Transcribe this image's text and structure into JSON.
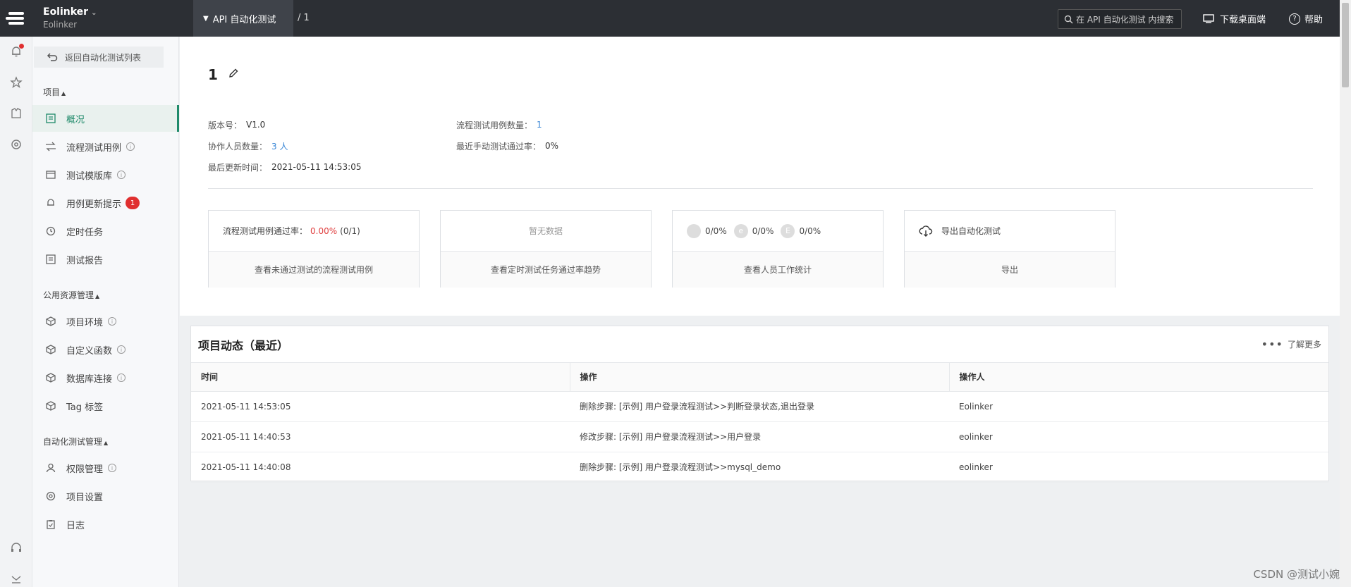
{
  "header": {
    "org": "Eolinker",
    "org_sub": "Eolinker",
    "active_tab": "API 自动化测试",
    "breadcrumb": "/ 1",
    "search_placeholder": "在 API 自动化测试 内搜索",
    "download": "下载桌面端",
    "help": "帮助"
  },
  "sidebar": {
    "back": "返回自动化测试列表",
    "section_project": "项目",
    "project_items": [
      {
        "label": "概况"
      },
      {
        "label": "流程测试用例"
      },
      {
        "label": "测试模版库"
      },
      {
        "label": "用例更新提示",
        "badge": "1"
      },
      {
        "label": "定时任务"
      },
      {
        "label": "测试报告"
      }
    ],
    "section_public": "公用资源管理",
    "public_items": [
      {
        "label": "项目环境"
      },
      {
        "label": "自定义函数"
      },
      {
        "label": "数据库连接"
      },
      {
        "label": "Tag 标签"
      }
    ],
    "section_auto": "自动化测试管理",
    "auto_items": [
      {
        "label": "权限管理"
      },
      {
        "label": "项目设置"
      },
      {
        "label": "日志"
      }
    ]
  },
  "overview": {
    "title": "1",
    "version_label": "版本号：",
    "version": "V1.0",
    "members_label": "协作人员数量：",
    "members": "3 人",
    "updated_label": "最后更新时间：",
    "updated": "2021-05-11 14:53:05",
    "cases_label": "流程测试用例数量：",
    "cases": "1",
    "pass_label": "最近手动测试通过率：",
    "pass": "0%"
  },
  "cards": {
    "c1_top_prefix": "流程测试用例通过率：",
    "c1_rate": "0.00%",
    "c1_count": "(0/1)",
    "c1_bottom": "查看未通过测试的流程测试用例",
    "c2_top": "暂无数据",
    "c2_bottom": "查看定时测试任务通过率趋势",
    "c3_stats": [
      {
        "letter": "",
        "value": "0/0%"
      },
      {
        "letter": "e",
        "value": "0/0%"
      },
      {
        "letter": "E",
        "value": "0/0%"
      }
    ],
    "c3_bottom": "查看人员工作统计",
    "c4_top": "导出自动化测试",
    "c4_bottom": "导出"
  },
  "activity": {
    "title": "项目动态（最近）",
    "more": "了解更多",
    "columns": [
      "时间",
      "操作",
      "操作人"
    ],
    "rows": [
      {
        "time": "2021-05-11 14:53:05",
        "action": "删除步骤: [示例] 用户登录流程测试>>判断登录状态,退出登录",
        "user": "Eolinker"
      },
      {
        "time": "2021-05-11 14:40:53",
        "action": "修改步骤: [示例] 用户登录流程测试>>用户登录",
        "user": "eolinker"
      },
      {
        "time": "2021-05-11 14:40:08",
        "action": "删除步骤: [示例] 用户登录流程测试>>mysql_demo",
        "user": "eolinker"
      }
    ]
  },
  "watermark": "CSDN @测试小婉"
}
